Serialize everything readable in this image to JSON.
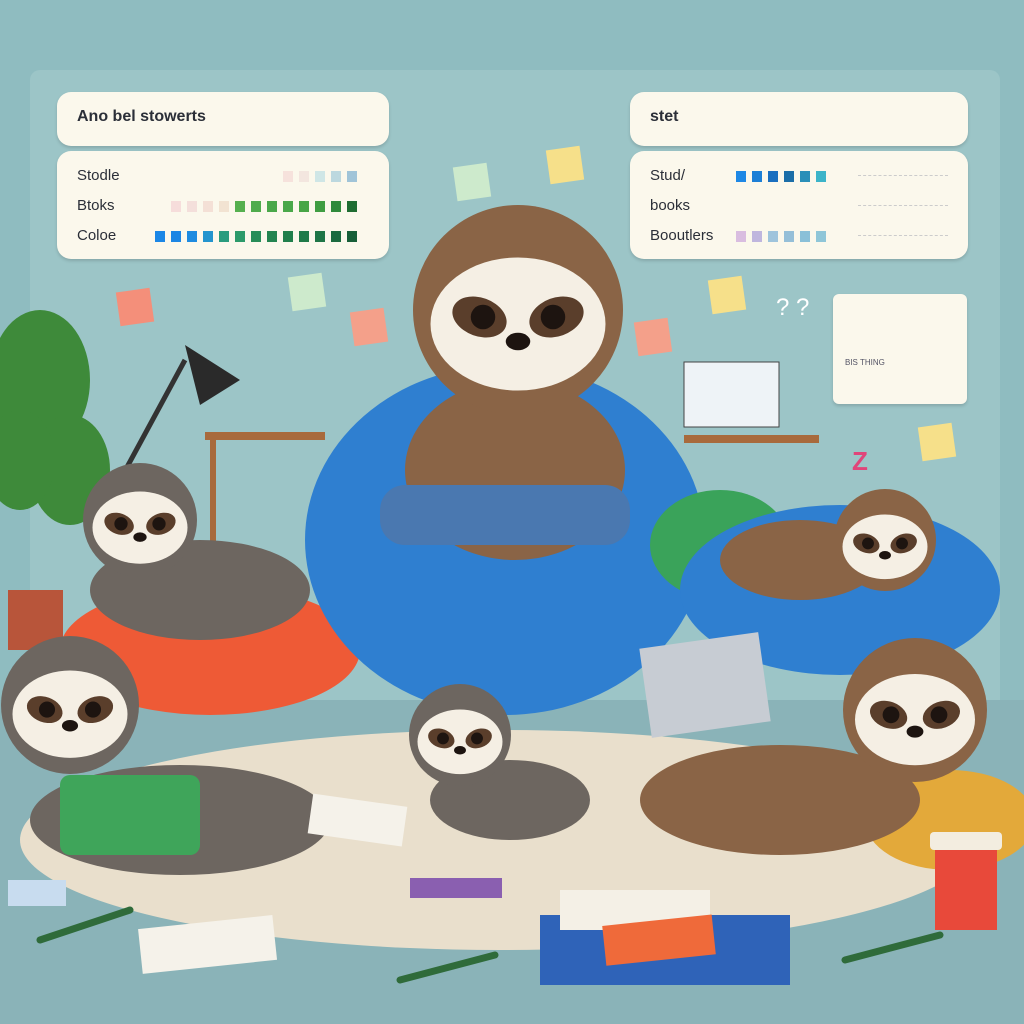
{
  "left_panel": {
    "title": "Ano bel stowerts",
    "rows": [
      {
        "label": "Stodle",
        "swatches": [
          "#f6e2dc",
          "#f3e6df",
          "#cfe6e6",
          "#bcd8df",
          "#a0c4d8"
        ]
      },
      {
        "label": "Btoks",
        "swatches": [
          "#f6dddb",
          "#f4dfdb",
          "#f4e0d6",
          "#f2e3d2",
          "#55b04f",
          "#4fab4c",
          "#4aa84a",
          "#4aa84a",
          "#48a546",
          "#3f9d42",
          "#2f8a3b",
          "#1f6d32"
        ]
      },
      {
        "label": "Coloe",
        "swatches": [
          "#1b87e6",
          "#1c86e4",
          "#1e8be0",
          "#2394ce",
          "#2a9c7e",
          "#2c9a6a",
          "#278d58",
          "#238450",
          "#217f4c",
          "#1f7a49",
          "#1e7546",
          "#1a6a3f",
          "#175f39"
        ]
      }
    ]
  },
  "right_panel": {
    "title": "stet",
    "rows": [
      {
        "label": "Stud/",
        "swatches": [
          "#1e88e5",
          "#1c7fd6",
          "#1a6fbf",
          "#1b6ea8",
          "#2a8fb8",
          "#3cb4c9"
        ]
      },
      {
        "label": "books",
        "swatches": []
      },
      {
        "label": "Booutlers",
        "swatches": [
          "#d9bde0",
          "#bfb6de",
          "#9fc4dc",
          "#95bfd8",
          "#8ac0d8",
          "#8fc6d8"
        ]
      }
    ]
  },
  "doodles": {
    "question": "? ?",
    "sleep": "Z",
    "chart_card_caption": "BIS THING"
  },
  "colors": {
    "background": "#8fbcc0",
    "sloth_brown": "#8a6446",
    "sloth_gray": "#6d6660",
    "beanbag_blue": "#2f7fd0",
    "beanbag_orange": "#ee5a36",
    "beanbag_green": "#3aa35a",
    "rug": "#e9dfcc"
  }
}
